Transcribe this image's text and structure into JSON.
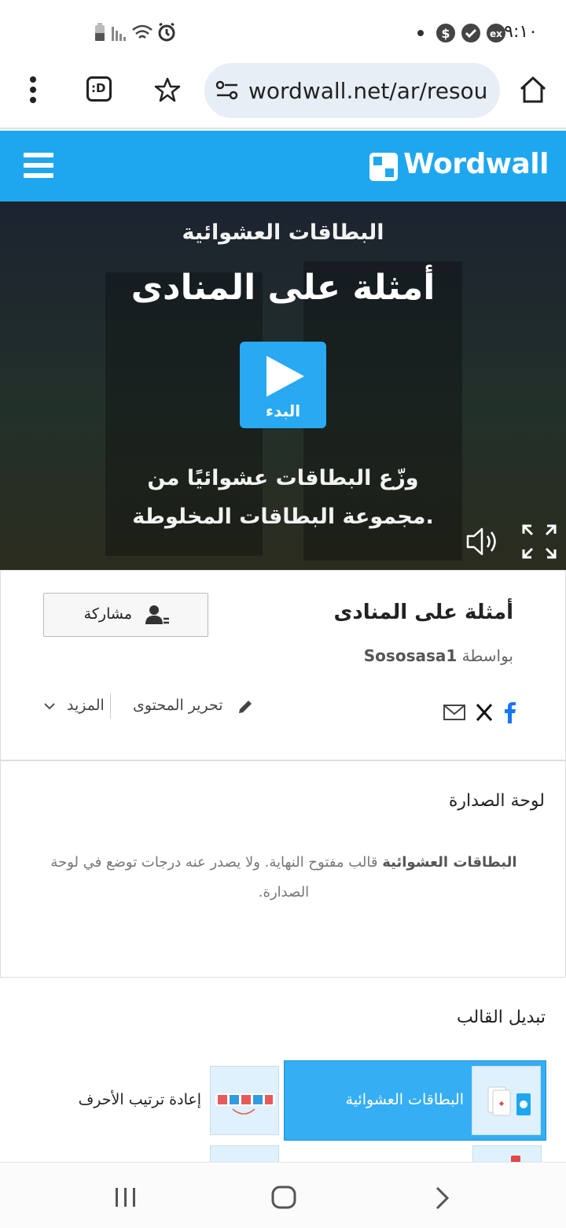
{
  "status_bar": {
    "time": "٩:١٠",
    "icons": [
      "battery-icon",
      "signal-icon",
      "wifi-icon",
      "alarm-icon",
      "dot-icon",
      "dollar-icon",
      "verified-icon",
      "ex-icon"
    ]
  },
  "browser": {
    "url": "wordwall.net/ar/resou",
    "menu_icon": "more-vert-icon",
    "tab_icon": "tab-switcher-icon",
    "tab_label": ":D",
    "bookmark_icon": "star-icon",
    "home_icon": "home-icon"
  },
  "site": {
    "brand": "Wordwall",
    "brand_color": "#1ea7ef",
    "menu_icon": "hamburger-icon"
  },
  "hero": {
    "template_name": "البطاقات العشوائية",
    "title": "أمثلة على المنادى",
    "play_label": "البدء",
    "description_line1": "وزّع البطاقات عشوائيًا من",
    "description_line2": "مجموعة البطاقات المخلوطة.",
    "accent": "#28a9f1"
  },
  "info": {
    "title": "أمثلة على المنادى",
    "by_prefix": "بواسطة",
    "author": "Sososasa1",
    "share_label": "مشاركة",
    "edit_label": "تحرير المحتوى",
    "more_label": "المزيد"
  },
  "leaderboard": {
    "title": "لوحة الصدارة",
    "bold_part": "البطاقات العشوائية",
    "text": " قالب مفتوح النهاية. ولا يصدر عنه درجات توضع في لوحة الصدارة."
  },
  "switch_template": {
    "title": "تبديل القالب",
    "items": [
      {
        "label": "البطاقات العشوائية",
        "active": true
      },
      {
        "label": "إعادة ترتيب الأحرف",
        "active": false
      }
    ]
  }
}
